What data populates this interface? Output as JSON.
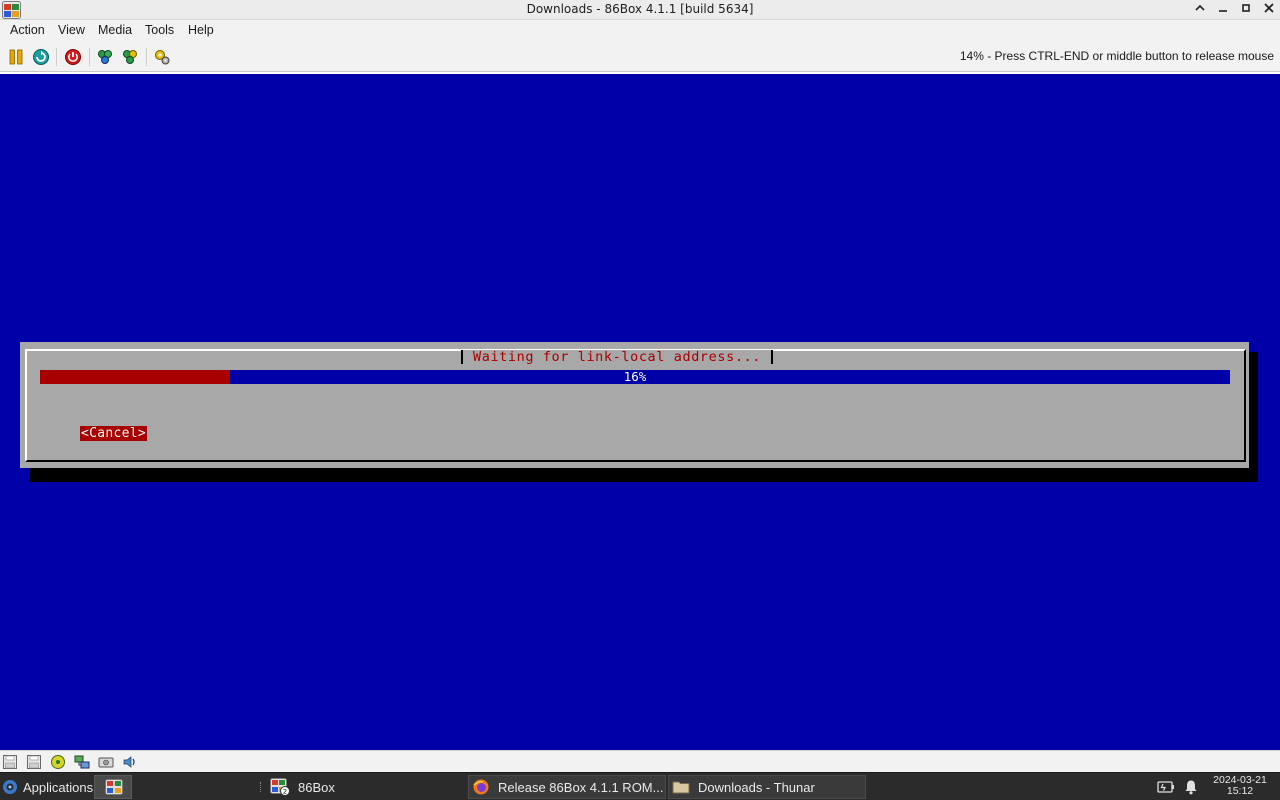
{
  "window": {
    "title": "Downloads - 86Box 4.1.1 [build 5634]"
  },
  "menubar": {
    "items": [
      {
        "label": "Action"
      },
      {
        "label": "View"
      },
      {
        "label": "Media"
      },
      {
        "label": "Tools"
      },
      {
        "label": "Help"
      }
    ]
  },
  "toolbar": {
    "icons": [
      "pause-icon",
      "reset-icon",
      "power-icon",
      "ctrl-alt-del-icon",
      "ctrl-alt-esc-icon",
      "settings-icon"
    ],
    "status_message": "14% - Press CTRL-END or middle button to release mouse"
  },
  "screen": {
    "dialog": {
      "title": "Waiting for link-local address...",
      "progress_percent": 16,
      "progress_label": "16%",
      "cancel_label": "<Cancel>"
    },
    "colors": {
      "background": "#0000a8",
      "dialog_bg": "#a8a8a8",
      "accent_red": "#a80000"
    }
  },
  "statusbar": {
    "icons": [
      "floppy-a-icon",
      "floppy-b-icon",
      "cdrom-icon",
      "network-icon",
      "hdd-icon",
      "sound-icon"
    ]
  },
  "taskbar": {
    "applications_label": "Applications",
    "tasks": [
      {
        "label": "86Box"
      },
      {
        "label": "Release 86Box 4.1.1 ROM..."
      },
      {
        "label": "Downloads - Thunar"
      }
    ],
    "clock": {
      "date": "2024-03-21",
      "time": "15:12"
    }
  }
}
